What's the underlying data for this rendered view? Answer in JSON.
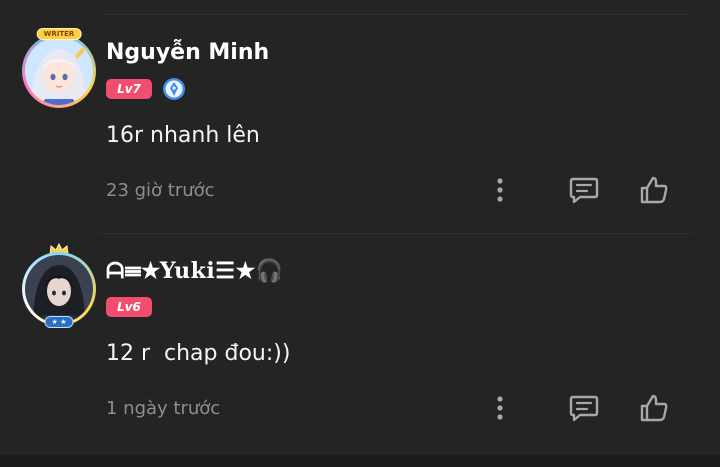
{
  "comments": [
    {
      "author": "Nguyễn Minh",
      "level": "Lv7",
      "frame_tag": "WRITER",
      "avatar_icon": "anime-girl-avatar",
      "badge_icon": "verified-writer-icon",
      "text": "16r nhanh lên",
      "time": "23 giờ trước",
      "actions": {
        "more_icon": "more-vertical-icon",
        "reply_icon": "reply-icon",
        "like_icon": "thumbs-up-icon"
      }
    },
    {
      "author": "ᗩ☰★Yuki☰★🎧",
      "level": "Lv6",
      "avatar_icon": "dark-hair-avatar",
      "text": "12 r  chap đou:))",
      "time": "1 ngày trước",
      "actions": {
        "more_icon": "more-vertical-icon",
        "reply_icon": "reply-icon",
        "like_icon": "thumbs-up-icon"
      }
    }
  ],
  "colors": {
    "background": "#242424",
    "level_badge": "#f24d6f",
    "muted_text": "#8e8e8e",
    "icon": "#a8a8a8",
    "verify_badge": "#3f8fe8"
  }
}
